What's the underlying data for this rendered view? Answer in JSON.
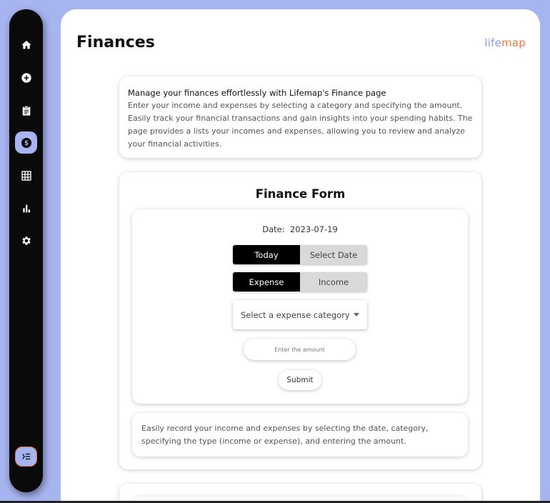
{
  "app": {
    "page_title": "Finances",
    "logo_part1": "life",
    "logo_part2": "map"
  },
  "colors": {
    "accent": "#a6b4f0",
    "logo_orange": "#ee7a3c",
    "sidebar_bg": "#0a0a0a"
  },
  "sidebar": {
    "items": [
      {
        "name": "home",
        "icon": "home-icon",
        "active": false
      },
      {
        "name": "add",
        "icon": "add-circle-icon",
        "active": false
      },
      {
        "name": "tasks",
        "icon": "clipboard-icon",
        "active": false
      },
      {
        "name": "finances",
        "icon": "dollar-icon",
        "active": true
      },
      {
        "name": "calendar",
        "icon": "grid-icon",
        "active": false
      },
      {
        "name": "stats",
        "icon": "bar-chart-icon",
        "active": false
      },
      {
        "name": "settings",
        "icon": "gear-icon",
        "active": false
      }
    ],
    "collapse_icon": "collapse-menu-icon"
  },
  "intro": {
    "heading": "Manage your finances effortlessly with Lifemap's Finance page",
    "body": "Enter your income and expenses by selecting a category and specifying the amount. Easily track your financial transactions and gain insights into your spending habits. The page provides a lists your incomes and expenses, allowing you to review and analyze your financial activities."
  },
  "form": {
    "title": "Finance Form",
    "date_label": "Date:",
    "date_value": "2023-07-19",
    "date_toggle": {
      "today": "Today",
      "select": "Select Date",
      "selected": "today"
    },
    "type_toggle": {
      "expense": "Expense",
      "income": "Income",
      "selected": "expense"
    },
    "category_placeholder": "Select a expense category",
    "amount_placeholder": "Enter the amount",
    "submit_label": "Submit"
  },
  "note": "Easily record your income and expenses by selecting the date, category, specifying the type (income or expense), and entering the amount."
}
